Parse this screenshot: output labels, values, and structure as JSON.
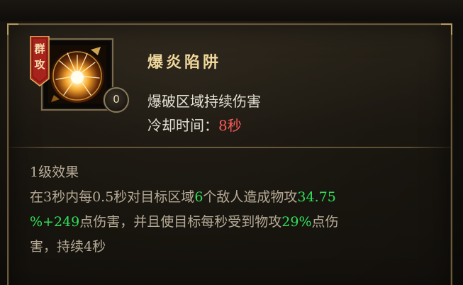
{
  "top_ghost_text": "",
  "skill": {
    "badge_label": [
      "群",
      "攻"
    ],
    "level": "0",
    "name": "爆炎陷阱",
    "description": "爆破区域持续伤害",
    "cooldown_label": "冷却时间：",
    "cooldown_value": "8秒"
  },
  "effect": {
    "title": "1级效果",
    "line1": {
      "t1": "在3秒内每0.5秒对目标区域",
      "n1": "6",
      "t2": "个敌人造成物攻",
      "n2": "34.75"
    },
    "line2": {
      "n1": "%+249",
      "t1": "点伤害，并且使目标每秒受到物攻",
      "n2": "29%",
      "t2": "点伤"
    },
    "line3": {
      "t1": "害，持续4秒"
    }
  },
  "colors": {
    "accent_red": "#ff5b58",
    "accent_green": "#2fe05a",
    "title_gold": "#f0d89c",
    "badge_red": "#a8231c"
  },
  "icons": {
    "skill_icon": "explosion-trap-icon",
    "badge": "group-attack-badge"
  }
}
